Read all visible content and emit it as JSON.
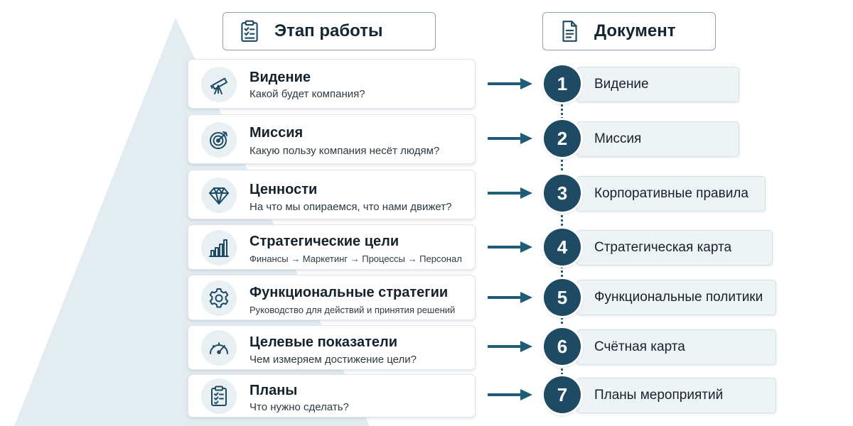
{
  "headers": {
    "stage": {
      "label": "Этап работы",
      "icon": "clipboard-checklist-icon"
    },
    "document": {
      "label": "Документ",
      "icon": "document-icon"
    }
  },
  "stages": [
    {
      "number": "1",
      "title": "Видение",
      "subtitle": "Какой будет компания?",
      "icon": "telescope-icon",
      "document": "Видение"
    },
    {
      "number": "2",
      "title": "Миссия",
      "subtitle": "Какую пользу компания несёт людям?",
      "icon": "target-icon",
      "document": "Миссия"
    },
    {
      "number": "3",
      "title": "Ценности",
      "subtitle": "На что мы опираемся, что нами движет?",
      "icon": "diamond-icon",
      "document": "Корпоративные правила"
    },
    {
      "number": "4",
      "title": "Стратегические цели",
      "subtitle": "Финансы → Маркетинг → Процессы → Персонал",
      "icon": "bar-chart-icon",
      "document": "Стратегическая карта"
    },
    {
      "number": "5",
      "title": "Функциональные стратегии",
      "subtitle": "Руководство для действий и принятия решений",
      "icon": "gear-icon",
      "document": "Функциональные политики"
    },
    {
      "number": "6",
      "title": "Целевые показатели",
      "subtitle": "Чем измеряем достижение цели?",
      "icon": "gauge-icon",
      "document": "Счётная карта"
    },
    {
      "number": "7",
      "title": "Планы",
      "subtitle": "Что нужно сделать?",
      "icon": "clipboard-checklist-icon",
      "document": "Планы мероприятий"
    }
  ],
  "colors": {
    "accent": "#1e4b63",
    "arrow": "#1f5c75",
    "pyramid": "#e3edf1",
    "doc_box": "#eef3f6",
    "icon_bg": "#e8f0f3"
  }
}
